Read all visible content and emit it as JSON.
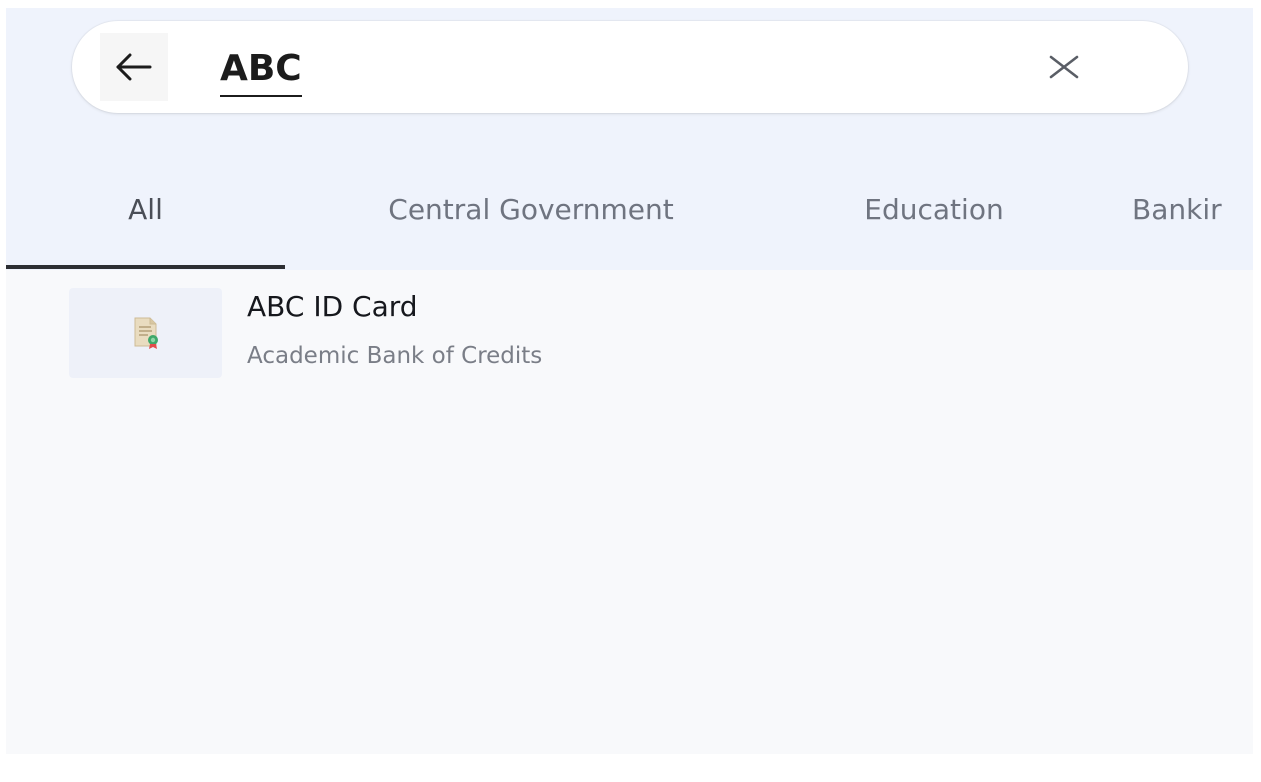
{
  "search": {
    "query": "ABC",
    "back_icon": "arrow-left-icon",
    "clear_icon": "close-icon"
  },
  "tabs": [
    {
      "label": "All",
      "active": true
    },
    {
      "label": "Central Government",
      "active": false
    },
    {
      "label": "Education",
      "active": false
    },
    {
      "label": "Bankir",
      "active": false
    }
  ],
  "results": [
    {
      "title": "ABC ID Card",
      "subtitle": "Academic Bank of Credits",
      "icon": "certificate-document-icon"
    }
  ],
  "colors": {
    "header_bg": "#eff3fc",
    "page_bg": "#f8f9fb",
    "tab_indicator": "#2c2e33",
    "tab_text": "#6f7480"
  }
}
